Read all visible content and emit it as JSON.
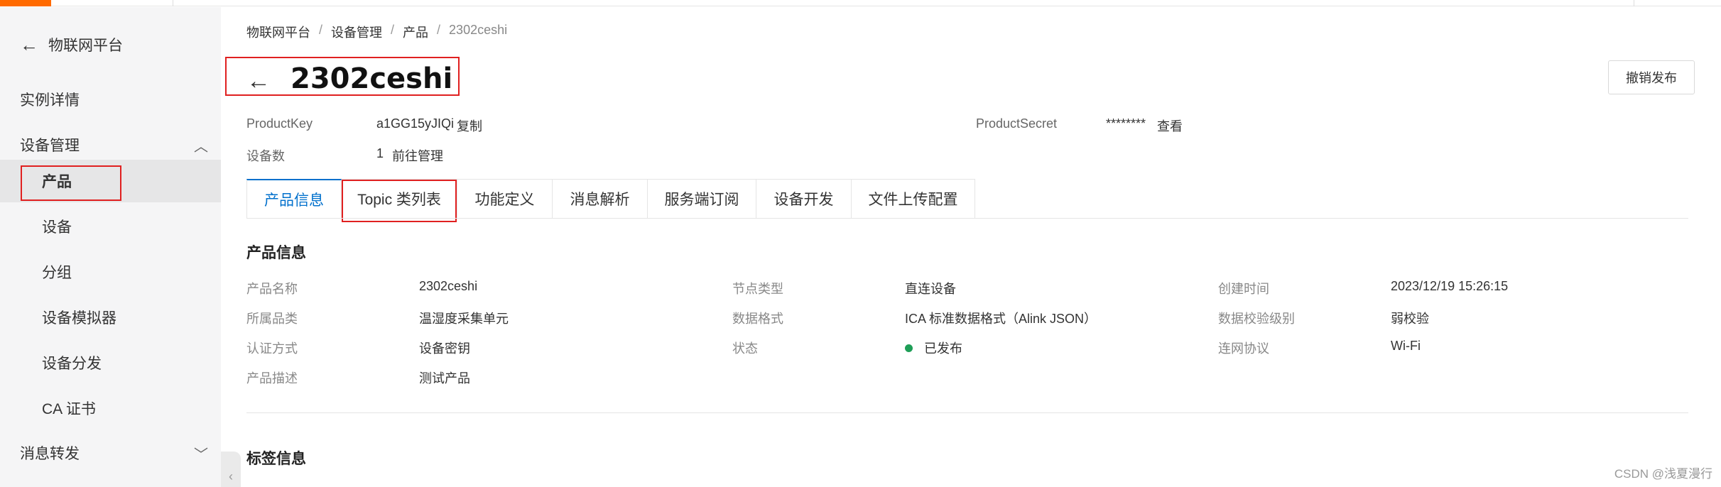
{
  "sidebar": {
    "back_label": "物联网平台",
    "items": [
      {
        "label": "实例详情"
      },
      {
        "label": "设备管理",
        "chevron": "chevron-up-icon"
      },
      {
        "label": "产品"
      },
      {
        "label": "设备"
      },
      {
        "label": "分组"
      },
      {
        "label": "设备模拟器"
      },
      {
        "label": "设备分发"
      },
      {
        "label": "CA 证书"
      },
      {
        "label": "消息转发",
        "chevron": "chevron-down-icon"
      }
    ]
  },
  "breadcrumb": [
    "物联网平台",
    "设备管理",
    "产品",
    "2302ceshi"
  ],
  "header": {
    "title": "2302ceshi",
    "revoke_button": "撤销发布"
  },
  "meta": {
    "product_key_label": "ProductKey",
    "product_key_value": "a1GG15yJIQi",
    "copy_link": "复制",
    "product_secret_label": "ProductSecret",
    "product_secret_value": "********",
    "view_link": "查看",
    "device_count_label": "设备数",
    "device_count_value": "1",
    "manage_link": "前往管理"
  },
  "tabs": [
    "产品信息",
    "Topic 类列表",
    "功能定义",
    "消息解析",
    "服务端订阅",
    "设备开发",
    "文件上传配置"
  ],
  "product_info": {
    "title": "产品信息",
    "fields": [
      {
        "label": "产品名称",
        "value": "2302ceshi"
      },
      {
        "label": "节点类型",
        "value": "直连设备"
      },
      {
        "label": "创建时间",
        "value": "2023/12/19 15:26:15"
      },
      {
        "label": "所属品类",
        "value": "温湿度采集单元"
      },
      {
        "label": "数据格式",
        "value": "ICA 标准数据格式（Alink JSON）"
      },
      {
        "label": "数据校验级别",
        "value": "弱校验"
      },
      {
        "label": "认证方式",
        "value": "设备密钥"
      },
      {
        "label": "状态",
        "value": "已发布"
      },
      {
        "label": "连网协议",
        "value": "Wi-Fi"
      },
      {
        "label": "产品描述",
        "value": "测试产品"
      }
    ]
  },
  "tag_info": {
    "title": "标签信息"
  },
  "watermark": "CSDN @浅夏漫行",
  "colors": {
    "accent": "#ff6a00",
    "link": "#0070cc",
    "highlight": "#e02020",
    "status_ok": "#1e9e57"
  }
}
